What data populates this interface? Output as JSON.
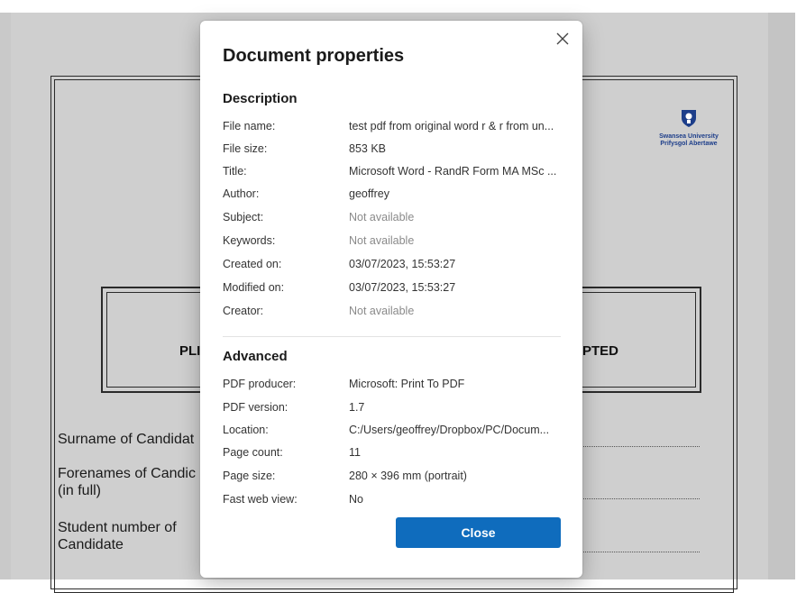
{
  "document_page": {
    "logo_line1": "Swansea University",
    "logo_line2": "Prifysgol Abertawe",
    "notice_left": "PLI",
    "notice_right": "EPTED",
    "surname_label": "Surname of Candidat",
    "forenames_label": "Forenames of Candic",
    "forenames_sub": "(in full)",
    "student_number_label": "Student number of",
    "student_number_sub": "Candidate"
  },
  "dialog": {
    "title": "Document properties",
    "close_button": "Close",
    "description": {
      "heading": "Description",
      "rows": [
        {
          "label": "File name:",
          "value": "test pdf from original word r & r from un..."
        },
        {
          "label": "File size:",
          "value": "853 KB"
        },
        {
          "label": "Title:",
          "value": "Microsoft Word - RandR Form MA MSc ..."
        },
        {
          "label": "Author:",
          "value": "geoffrey"
        },
        {
          "label": "Subject:",
          "value": "Not available"
        },
        {
          "label": "Keywords:",
          "value": "Not available"
        },
        {
          "label": "Created on:",
          "value": "03/07/2023, 15:53:27"
        },
        {
          "label": "Modified on:",
          "value": "03/07/2023, 15:53:27"
        },
        {
          "label": "Creator:",
          "value": "Not available"
        }
      ]
    },
    "advanced": {
      "heading": "Advanced",
      "rows": [
        {
          "label": "PDF producer:",
          "value": "Microsoft: Print To PDF"
        },
        {
          "label": "PDF version:",
          "value": "1.7"
        },
        {
          "label": "Location:",
          "value": "C:/Users/geoffrey/Dropbox/PC/Docum..."
        },
        {
          "label": "Page count:",
          "value": "11"
        },
        {
          "label": "Page size:",
          "value": "280 × 396 mm (portrait)"
        },
        {
          "label": "Fast web view:",
          "value": "No"
        }
      ]
    }
  },
  "colors": {
    "accent": "#0f6cbd",
    "muted_text": "#8a8a8a",
    "logo_blue": "#1d3e8a"
  },
  "icons": {
    "close": "close-icon",
    "crest": "university-crest-icon"
  }
}
